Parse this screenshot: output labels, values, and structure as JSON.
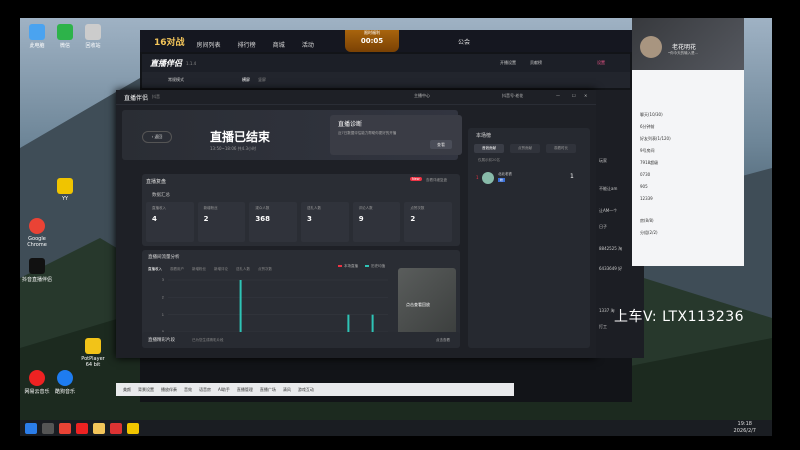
{
  "desktop": {
    "icons": [
      {
        "label": "此电脑",
        "color": "#4aa3f0"
      },
      {
        "label": "微信",
        "color": "#2db34a"
      },
      {
        "label": "回收站",
        "color": "#ccc"
      },
      {
        "label": "Google Chrome",
        "color": "#ea4335"
      },
      {
        "label": "YY",
        "color": "#f0c400"
      },
      {
        "label": "抖音直播伴侣",
        "color": "#111"
      },
      {
        "label": "网易云音乐",
        "color": "#e22"
      },
      {
        "label": "酷狗音乐",
        "color": "#1e7cf0"
      },
      {
        "label": "PotPlayer 64 bit",
        "color": "#f2c318"
      }
    ],
    "taskbar_time": "19:18",
    "taskbar_date": "2026/2/7"
  },
  "game_window": {
    "logo": "16对战",
    "nav": [
      "房间列表",
      "排行榜",
      "商城",
      "活动",
      "公会"
    ],
    "timer_label": "限时福利",
    "timer_value": "00:05"
  },
  "helper_window": {
    "logo": "直播伴侣",
    "version": "1.1.4",
    "sub_tabs": [
      "常规模式",
      "横屏",
      "竖屏"
    ],
    "top_right": [
      "开播设置",
      "贡献榜",
      "设置"
    ]
  },
  "main_window": {
    "brand": "直播伴侣",
    "brand_sub": "抖音",
    "title_right": [
      "主播中心",
      "抖音号·老花"
    ],
    "back_label": "返回",
    "heading": "直播已结束",
    "heading_sub": "13:50~18:06 共4.3小时",
    "diagnosis": {
      "title": "直播诊断",
      "text": "近7日数据评估能力帮助你更好的开播",
      "button": "查看"
    },
    "review": {
      "title": "直播复盘",
      "new_tag": "New",
      "link": "查看详细复盘",
      "section": "数据汇总",
      "stats": [
        {
          "label": "直播收入",
          "value": "4"
        },
        {
          "label": "新增粉丝",
          "value": "2"
        },
        {
          "label": "观众人数",
          "value": "368"
        },
        {
          "label": "送礼人数",
          "value": "3"
        },
        {
          "label": "评论人数",
          "value": "9"
        },
        {
          "label": "点赞次数",
          "value": "2"
        }
      ]
    },
    "analysis": {
      "title": "直播间流量分析",
      "tabs": [
        "直播收入",
        "观看用户",
        "新增粉丝",
        "新增评论",
        "送礼人数",
        "点赞次数"
      ],
      "legend": [
        "本场直播",
        "历史均值"
      ],
      "side_card": "点击查看回放"
    },
    "highlight": {
      "title": "直播精彩片段",
      "sub": "已为您生成精彩片段",
      "link": "点击查看"
    },
    "ranking": {
      "title": "本场榜",
      "tabs": [
        "音浪贡献",
        "点赞贡献",
        "观看时长"
      ],
      "note": "仅展示前20名",
      "rows": [
        {
          "rank": "1",
          "name": "北北老铁",
          "tag": "粉",
          "score": "1"
        }
      ]
    }
  },
  "chart_data": {
    "type": "bar",
    "title": "直播间流量分析",
    "xlabel": "",
    "ylabel": "",
    "x_ticks": [
      "2026-02-07 13:50:00",
      "2026-02-07 15:05:00",
      "2026-02-07 16:20:00",
      "2026-02-07 17:35:00"
    ],
    "ylim": [
      0,
      3
    ],
    "y_ticks": [
      0,
      1,
      2,
      3
    ],
    "series": [
      {
        "name": "本场直播",
        "points": [
          [
            0.33,
            3
          ],
          [
            0.82,
            1
          ],
          [
            0.93,
            1
          ]
        ]
      }
    ]
  },
  "bottom_bar": [
    "美颜",
    "背景设置",
    "播放伴奏",
    "音效",
    "语音房",
    "AI助手",
    "直播管理",
    "直播广场",
    "清风",
    "游戏互动"
  ],
  "right_panel": {
    "name": "老花明花",
    "sub": "•你今天的输入是…",
    "items": [
      "聊天(10/30)",
      "6分钟前",
      "好友列表(1/120)",
      "9号房间",
      "7918超级",
      "0730",
      "905",
      "12339",
      "房(8/8)",
      "分组(2/2)"
    ]
  },
  "dark_strip": [
    "玩家",
    "不能让am",
    "让AM一个",
    "日子",
    "8842525 淘",
    "6433649 好",
    "1337 淘",
    "打工"
  ],
  "watermark": "上车V:  LTX113236"
}
